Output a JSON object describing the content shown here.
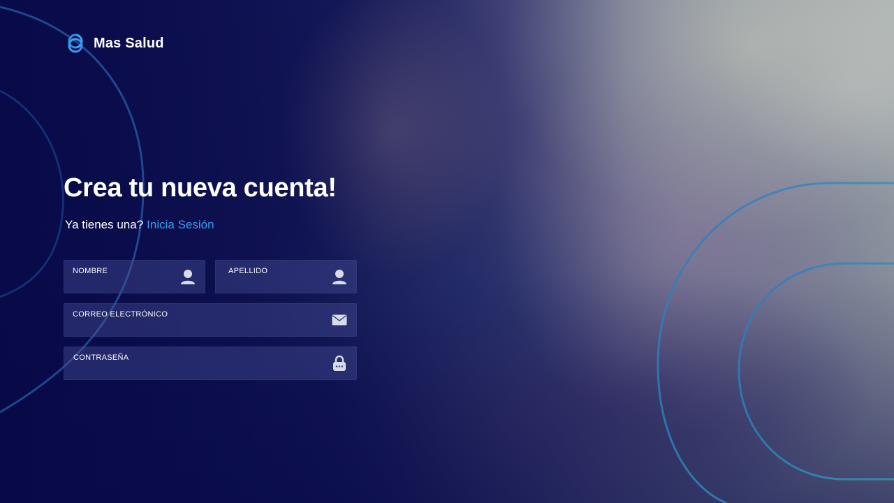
{
  "brand": {
    "name": "Mas Salud",
    "logo_icon": "linked-rings-logo-icon"
  },
  "heading": {
    "title": "Crea tu nueva cuenta!",
    "subtitle_prefix": "Ya tienes una?",
    "login_link": "Inicia Sesión"
  },
  "form": {
    "first_name": {
      "label": "NOMBRE",
      "value": "",
      "placeholder": "",
      "icon": "user-icon"
    },
    "last_name": {
      "label": "APELLIDO",
      "value": "",
      "placeholder": "",
      "icon": "user-icon"
    },
    "email": {
      "label": "CORREO ELECTRÓNICO",
      "value": "",
      "placeholder": "",
      "icon": "envelope-icon"
    },
    "password": {
      "label": "CONTRASEÑA",
      "value": "",
      "placeholder": "",
      "icon": "lock-icon"
    }
  },
  "colors": {
    "background": "#0b0d4a",
    "accent_link": "#3a9bf0",
    "decor_stroke": "#2f8fcf"
  }
}
